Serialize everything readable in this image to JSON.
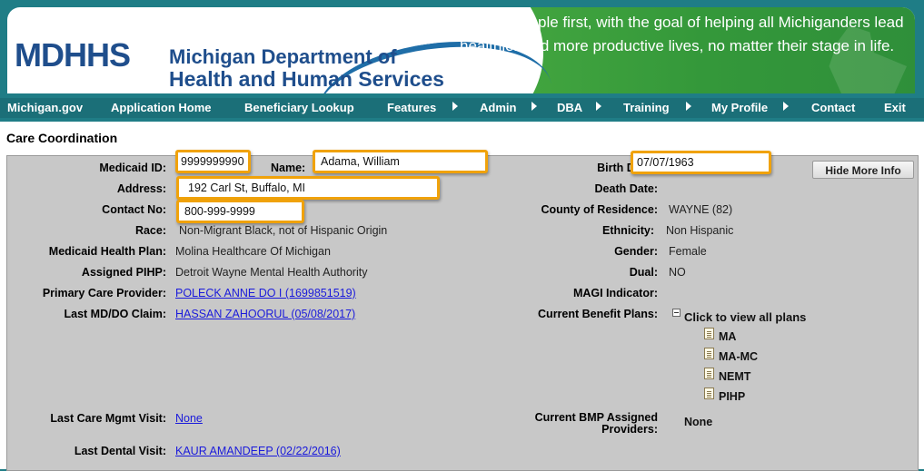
{
  "header": {
    "tagline": "Putting people first, with the goal of helping all Michiganders lead healthier and more productive lives, no matter their stage in life.",
    "logo_text": "MDHHS",
    "dept_line1": "Michigan Department of",
    "dept_line2": "Health and Human Services"
  },
  "nav": {
    "items": [
      {
        "label": "Michigan.gov"
      },
      {
        "label": "Application Home"
      },
      {
        "label": "Beneficiary Lookup"
      },
      {
        "label": "Features"
      },
      {
        "label": "Admin"
      },
      {
        "label": "DBA"
      },
      {
        "label": "Training"
      },
      {
        "label": "My Profile"
      },
      {
        "label": "Contact"
      },
      {
        "label": "Exit"
      }
    ]
  },
  "page": {
    "title": "Care Coordination",
    "hide_button": "Hide More Info"
  },
  "left": {
    "medicaid_id": {
      "label": "Medicaid ID:",
      "value": "9999999990"
    },
    "name": {
      "label": "Name:",
      "value": "Adama, William"
    },
    "address": {
      "label": "Address:",
      "value": "192 Carl St, Buffalo, MI"
    },
    "contact": {
      "label": "Contact No:",
      "value": "800-999-9999"
    },
    "race": {
      "label": "Race:",
      "value": "Non-Migrant Black, not of Hispanic Origin"
    },
    "health_plan": {
      "label": "Medicaid Health Plan:",
      "value": "Molina Healthcare Of Michigan"
    },
    "pihp": {
      "label": "Assigned PIHP:",
      "value": "Detroit Wayne Mental Health Authority"
    },
    "pcp": {
      "label": "Primary Care Provider:",
      "value": "POLECK ANNE DO I  (1699851519)"
    },
    "last_md": {
      "label": "Last MD/DO Claim:",
      "value": "HASSAN ZAHOORUL   (05/08/2017)"
    },
    "last_care_mgmt": {
      "label": "Last Care Mgmt Visit:",
      "value": "None"
    },
    "last_dental": {
      "label": "Last Dental Visit:",
      "value": "KAUR AMANDEEP   (02/22/2016)"
    }
  },
  "right": {
    "birth_date": {
      "label": "Birth Date:",
      "value": "07/07/1963"
    },
    "death_date": {
      "label": "Death Date:",
      "value": ""
    },
    "county": {
      "label": "County of Residence:",
      "value": "WAYNE (82)"
    },
    "ethnicity": {
      "label": "Ethnicity:",
      "value": "Non Hispanic"
    },
    "gender": {
      "label": "Gender:",
      "value": "Female"
    },
    "dual": {
      "label": "Dual:",
      "value": "NO"
    },
    "magi": {
      "label": "MAGI Indicator:",
      "value": ""
    },
    "benefit_plans": {
      "label": "Current Benefit Plans:",
      "toggle_text": "Click to view all plans",
      "plans": [
        {
          "label": "MA"
        },
        {
          "label": "MA-MC"
        },
        {
          "label": "NEMT"
        },
        {
          "label": "PIHP"
        }
      ]
    },
    "bmp": {
      "label_line1": "Current BMP Assigned",
      "label_line2": "Providers:",
      "value": "None"
    }
  },
  "colors": {
    "highlight_border": "#f0a20a",
    "nav_bg": "#1b6f78",
    "banner_green": "#34983a",
    "link": "#1a1adb"
  }
}
